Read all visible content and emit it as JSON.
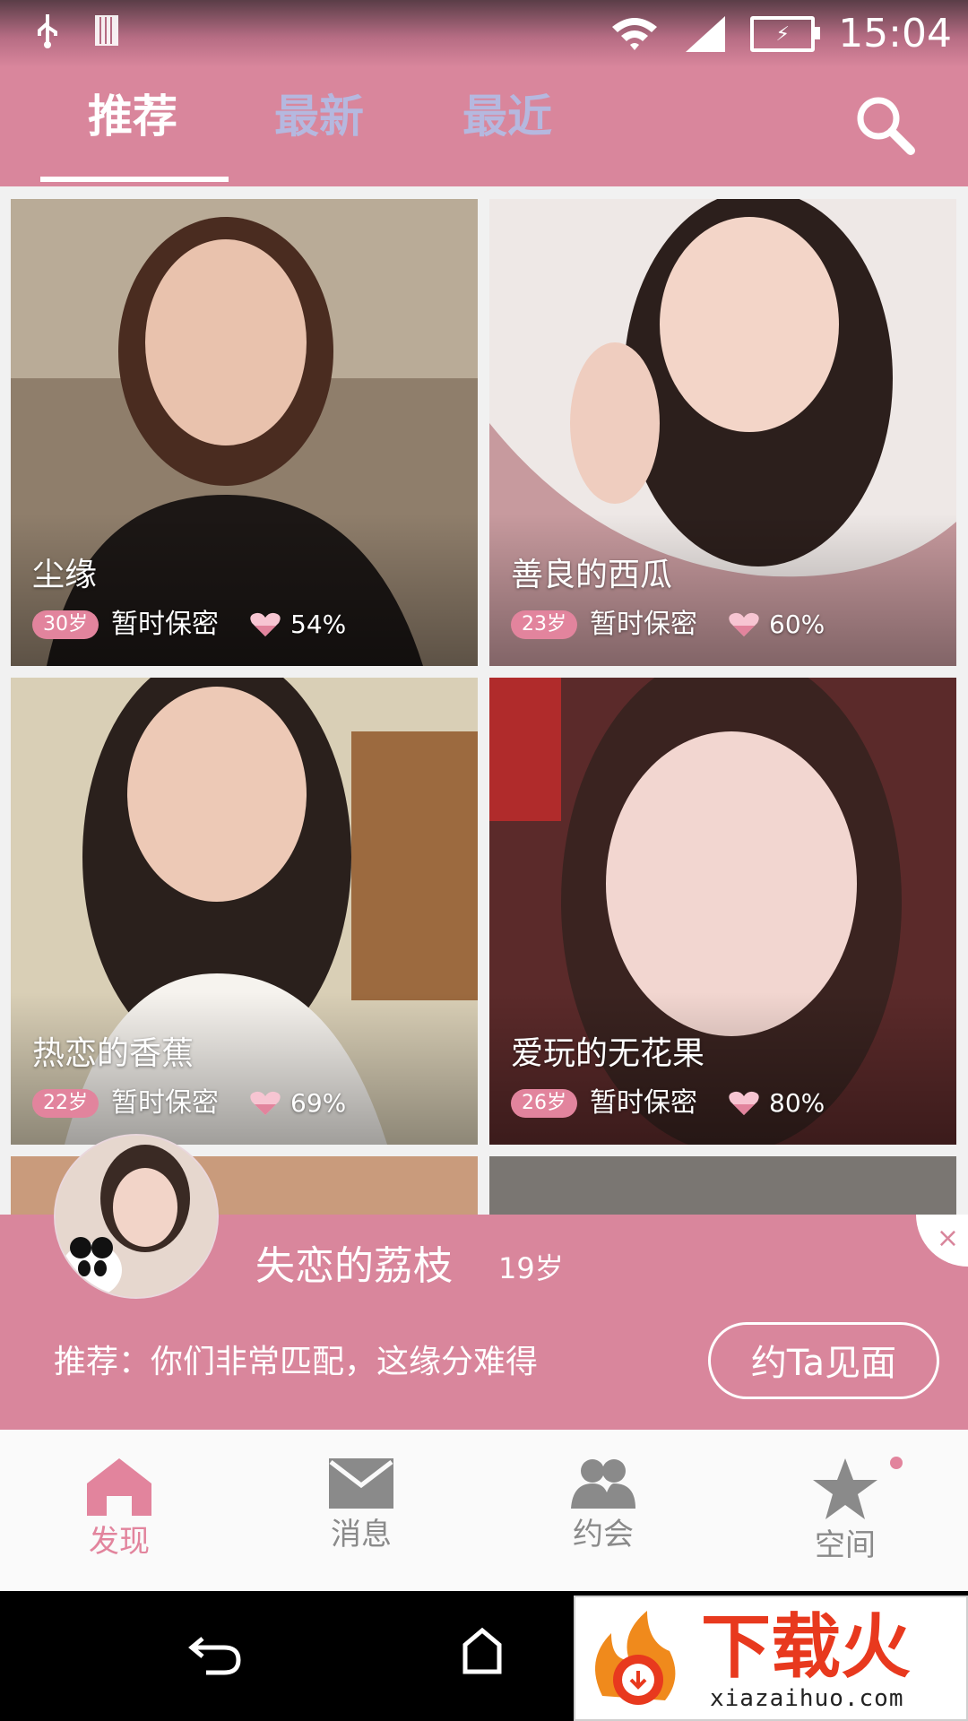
{
  "status_bar": {
    "time": "15:04"
  },
  "tabs": [
    {
      "label": "推荐",
      "active": true
    },
    {
      "label": "最新",
      "active": false
    },
    {
      "label": "最近",
      "active": false
    }
  ],
  "cards": [
    {
      "name": "尘缘",
      "age": "30岁",
      "info": "暂时保密",
      "match": "54%"
    },
    {
      "name": "善良的西瓜",
      "age": "23岁",
      "info": "暂时保密",
      "match": "60%"
    },
    {
      "name": "热恋的香蕉",
      "age": "22岁",
      "info": "暂时保密",
      "match": "69%"
    },
    {
      "name": "爱玩的无花果",
      "age": "26岁",
      "info": "暂时保密",
      "match": "80%"
    }
  ],
  "popup": {
    "name": "失恋的荔枝",
    "age": "19岁",
    "recommend": "推荐：你们非常匹配，这缘分难得",
    "button": "约Ta见面",
    "close": "×"
  },
  "bottom_nav": [
    {
      "label": "发现",
      "icon": "home-icon",
      "active": true
    },
    {
      "label": "消息",
      "icon": "mail-icon",
      "active": false
    },
    {
      "label": "约会",
      "icon": "people-icon",
      "active": false
    },
    {
      "label": "空间",
      "icon": "star-icon",
      "active": false
    }
  ],
  "watermark": {
    "text": "下载火",
    "url": "xiazaihuo.com"
  },
  "colors": {
    "accent": "#d9869c",
    "badge": "#e2849d",
    "tab_inactive": "#b5b8df"
  }
}
